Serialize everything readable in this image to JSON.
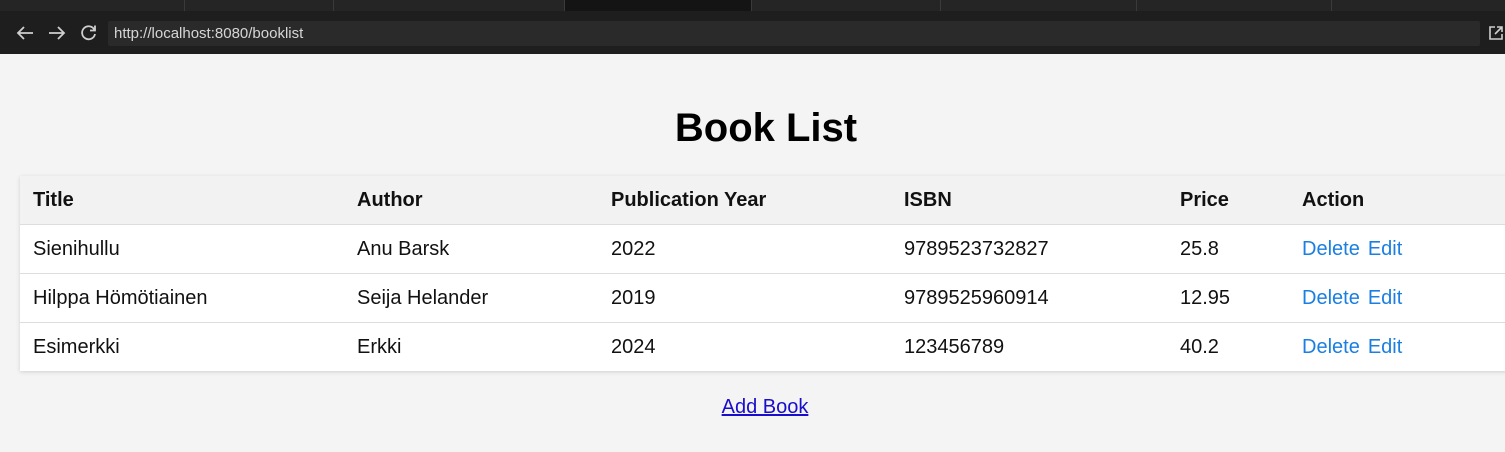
{
  "browser": {
    "url": "http://localhost:8080/booklist"
  },
  "page": {
    "title": "Book List",
    "add_link": "Add Book"
  },
  "table": {
    "headers": [
      "Title",
      "Author",
      "Publication Year",
      "ISBN",
      "Price",
      "Action"
    ],
    "rows": [
      {
        "title": "Sienihullu",
        "author": "Anu Barsk",
        "year": "2022",
        "isbn": "9789523732827",
        "price": "25.8"
      },
      {
        "title": "Hilppa Hömötiainen",
        "author": "Seija Helander",
        "year": "2019",
        "isbn": "9789525960914",
        "price": "12.95"
      },
      {
        "title": "Esimerkki",
        "author": "Erkki",
        "year": "2024",
        "isbn": "123456789",
        "price": "40.2"
      }
    ],
    "delete_label": "Delete",
    "edit_label": "Edit"
  },
  "colors": {
    "link": "#1a7fe0",
    "add_link": "#1a0dcc",
    "chrome": "#1e1e1e"
  }
}
